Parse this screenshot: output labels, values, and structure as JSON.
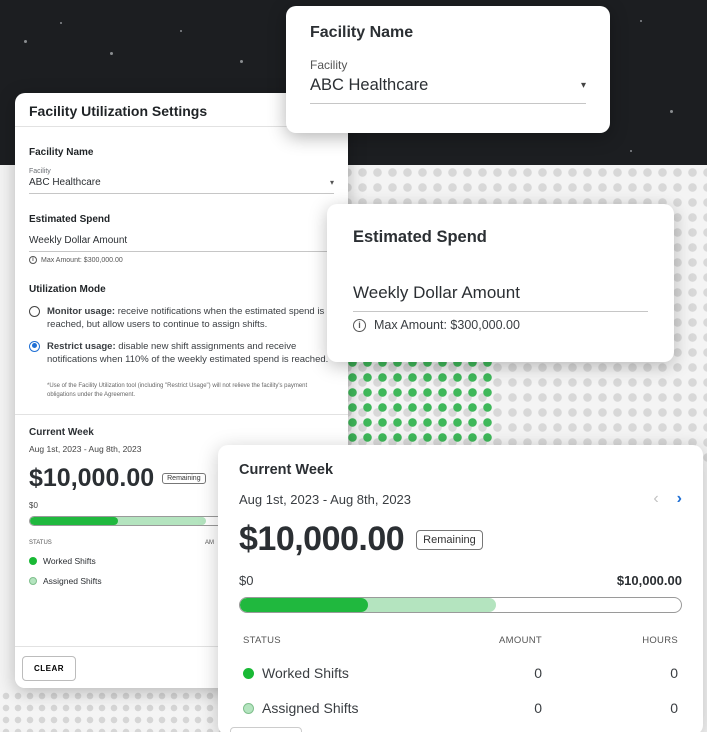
{
  "settings": {
    "title": "Facility Utilization Settings",
    "facility_section": "Facility Name",
    "facility_label": "Facility",
    "facility_value": "ABC Healthcare",
    "spend_section": "Estimated Spend",
    "spend_value": "Weekly Dollar Amount",
    "spend_hint": "Max Amount: $300,000.00",
    "mode_section": "Utilization Mode",
    "monitor_title": "Monitor usage:",
    "monitor_desc": " receive notifications when the estimated spend is reached, but allow users to continue to assign shifts.",
    "restrict_title": "Restrict usage:",
    "restrict_desc": " disable new shift assignments and receive notifications when 110% of the weekly estimated spend is reached.",
    "selected_mode": "restrict",
    "fineprint": "*Use of the Facility Utilization tool (including \"Restrict Usage\") will not relieve the facility's payment obligations under the Agreement.",
    "week_title": "Current Week",
    "week_dates": "Aug 1st, 2023 - Aug 8th, 2023",
    "week_amount": "$10,000.00",
    "remaining_badge": "Remaining",
    "zero": "$0",
    "status_header": "STATUS",
    "amount_header_partial": "AM",
    "worked_label": "Worked Shifts",
    "assigned_label": "Assigned Shifts",
    "clear_button": "CLEAR"
  },
  "facility_card": {
    "title": "Facility Name",
    "label": "Facility",
    "value": "ABC Healthcare"
  },
  "spend_card": {
    "title": "Estimated Spend",
    "value": "Weekly Dollar Amount",
    "hint": "Max Amount: $300,000.00"
  },
  "week_card": {
    "title": "Current Week",
    "dates": "Aug 1st, 2023 - Aug 8th, 2023",
    "amount": "$10,000.00",
    "badge": "Remaining",
    "min_label": "$0",
    "max_label": "$10,000.00",
    "progress": {
      "worked_fraction": 0.29,
      "assigned_fraction": 0.58
    },
    "columns": [
      "STATUS",
      "AMOUNT",
      "HOURS"
    ],
    "rows": [
      {
        "status": "Worked Shifts",
        "amount": "0",
        "hours": "0"
      },
      {
        "status": "Assigned Shifts",
        "amount": "0",
        "hours": "0"
      }
    ]
  },
  "colors": {
    "worked": "#20b83e",
    "assigned": "#b4e4bf",
    "accent": "#1f6fd4",
    "background_dark": "#1c1e21"
  },
  "icons": {
    "info": "info-circle-icon",
    "caret": "caret-down-icon",
    "prev": "chevron-left-icon",
    "next": "chevron-right-icon"
  }
}
